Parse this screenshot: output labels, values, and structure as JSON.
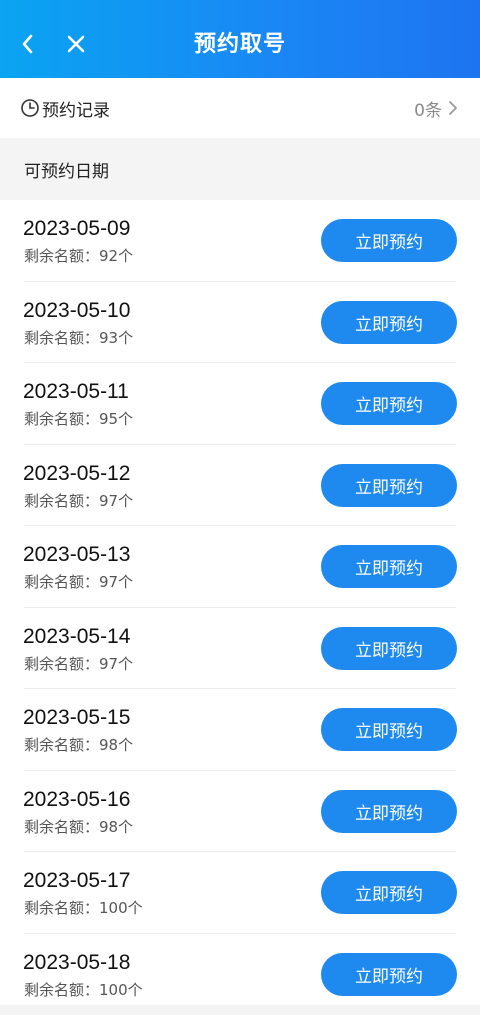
{
  "header": {
    "title": "预约取号"
  },
  "records": {
    "label": "预约记录",
    "count": "0条"
  },
  "section": {
    "title": "可预约日期"
  },
  "slots": [
    {
      "date": "2023-05-09",
      "remaining": "剩余名额：92个",
      "button": "立即预约"
    },
    {
      "date": "2023-05-10",
      "remaining": "剩余名额：93个",
      "button": "立即预约"
    },
    {
      "date": "2023-05-11",
      "remaining": "剩余名额：95个",
      "button": "立即预约"
    },
    {
      "date": "2023-05-12",
      "remaining": "剩余名额：97个",
      "button": "立即预约"
    },
    {
      "date": "2023-05-13",
      "remaining": "剩余名额：97个",
      "button": "立即预约"
    },
    {
      "date": "2023-05-14",
      "remaining": "剩余名额：97个",
      "button": "立即预约"
    },
    {
      "date": "2023-05-15",
      "remaining": "剩余名额：98个",
      "button": "立即预约"
    },
    {
      "date": "2023-05-16",
      "remaining": "剩余名额：98个",
      "button": "立即预约"
    },
    {
      "date": "2023-05-17",
      "remaining": "剩余名额：100个",
      "button": "立即预约"
    },
    {
      "date": "2023-05-18",
      "remaining": "剩余名额：100个",
      "button": "立即预约"
    }
  ]
}
